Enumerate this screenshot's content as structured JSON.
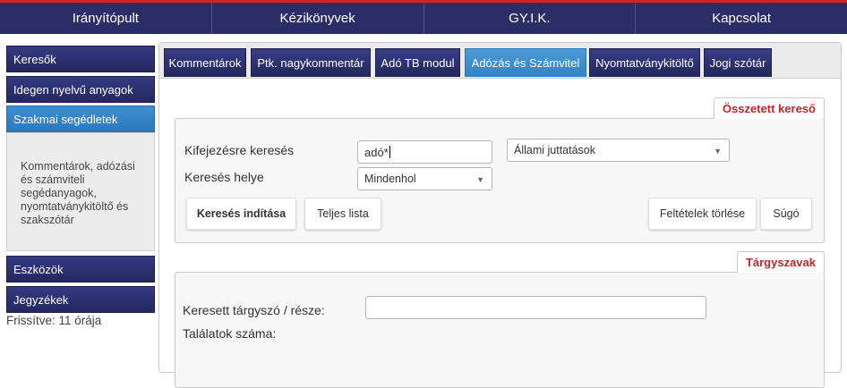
{
  "topnav": {
    "items": [
      "Irányítópult",
      "Kézikönyvek",
      "GY.I.K.",
      "Kapcsolat"
    ]
  },
  "sidebar": {
    "kereso": "Keresők",
    "idegen": "Idegen nyelvű anyagok",
    "szakmai": "Szakmai segédletek",
    "szakmai_desc": "Kommentárok, adózási és számviteli segédanyagok, nyomtatványkitöltő és szakszótár",
    "eszkozok": "Eszközök",
    "jegyzekek": "Jegyzékek",
    "updated": "Frissítve: 11 órája"
  },
  "tabs": [
    "Kommentárok",
    "Ptk. nagykommentár",
    "Adó TB modul",
    "Adózás és Számvitel",
    "Nyomtatványkitöltő",
    "Jogi szótár"
  ],
  "active_tab_index": 3,
  "composite_search": {
    "legend": "Összetett kereső",
    "phrase_label": "Kifejezésre keresés",
    "phrase_value": "adó*",
    "category_select": "Állami juttatások",
    "location_label": "Keresés helye",
    "location_select": "Mindenhol",
    "search_button": "Keresés indítása",
    "full_list_button": "Teljes lista",
    "clear_button": "Feltételek törlése",
    "help_button": "Súgó"
  },
  "subject_terms": {
    "legend": "Tárgyszavak",
    "term_label": "Keresett tárgyszó / része:",
    "term_value": "",
    "results_label": "Találatok száma:"
  },
  "colors": {
    "nav_bg": "#2b2e66",
    "accent_red": "#c0242a",
    "active_blue": "#3582c4"
  }
}
